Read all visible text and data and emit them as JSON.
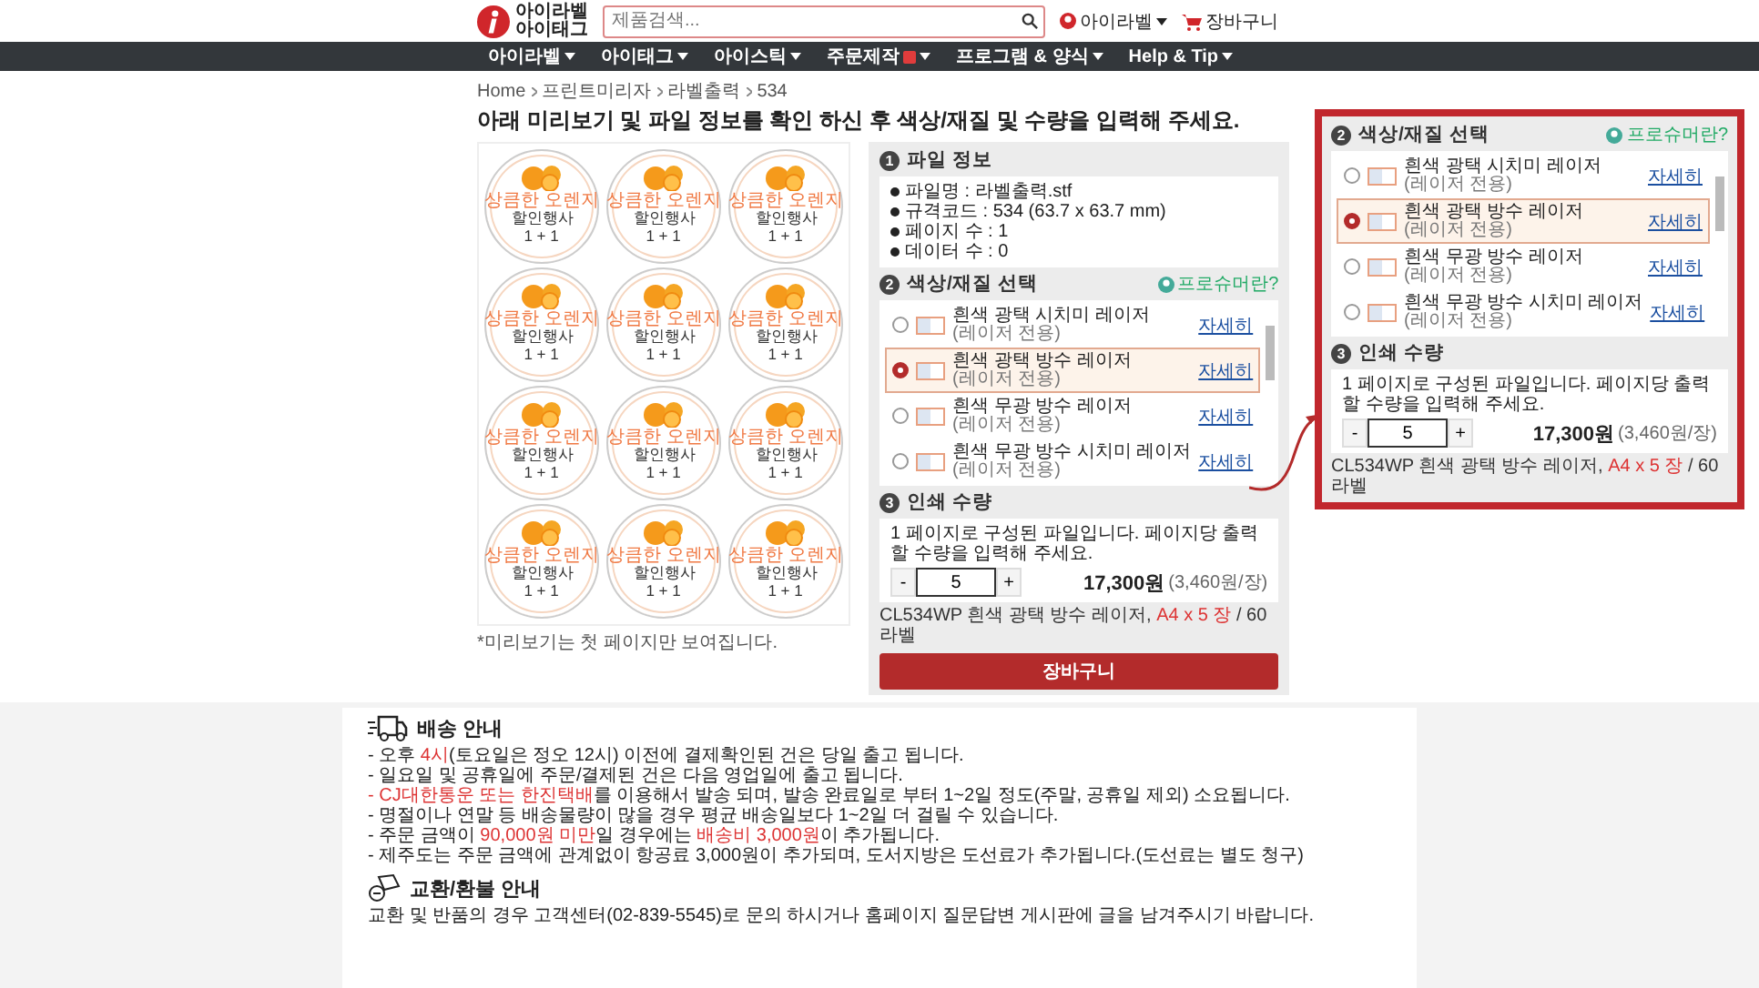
{
  "header": {
    "logo_lines": [
      "아이라벨",
      "아이태그"
    ],
    "search": {
      "placeholder": "제품검색..."
    },
    "user": "아이라벨",
    "cart": "장바구니"
  },
  "nav": [
    {
      "label": "아이라벨",
      "badge": false
    },
    {
      "label": "아이태그",
      "badge": false
    },
    {
      "label": "아이스틱",
      "badge": false
    },
    {
      "label": "주문제작",
      "badge": true
    },
    {
      "label": "프로그램 & 양식",
      "badge": false
    },
    {
      "label": "Help & Tip",
      "badge": false
    }
  ],
  "breadcrumb": [
    "Home",
    "프린트미리자",
    "라벨출력",
    "534"
  ],
  "title": "아래 미리보기 및 파일 정보를 확인 하신 후 색상/재질 및 수량을 입력해 주세요.",
  "preview": {
    "labels": [
      {
        "title": "상큼한 오렌지",
        "line_1": "할인행사",
        "line_2": "1 + 1"
      },
      {
        "title": "상큼한 오렌지",
        "line_1": "할인행사",
        "line_2": "1 + 1"
      },
      {
        "title": "상큼한 오렌지",
        "line_1": "할인행사",
        "line_2": "1 + 1"
      },
      {
        "title": "상큼한 오렌지",
        "line_1": "할인행사",
        "line_2": "1 + 1"
      },
      {
        "title": "상큼한 오렌지",
        "line_1": "할인행사",
        "line_2": "1 + 1"
      },
      {
        "title": "상큼한 오렌지",
        "line_1": "할인행사",
        "line_2": "1 + 1"
      },
      {
        "title": "상큼한 오렌지",
        "line_1": "할인행사",
        "line_2": "1 + 1"
      },
      {
        "title": "상큼한 오렌지",
        "line_1": "할인행사",
        "line_2": "1 + 1"
      },
      {
        "title": "상큼한 오렌지",
        "line_1": "할인행사",
        "line_2": "1 + 1"
      },
      {
        "title": "상큼한 오렌지",
        "line_1": "할인행사",
        "line_2": "1 + 1"
      },
      {
        "title": "상큼한 오렌지",
        "line_1": "할인행사",
        "line_2": "1 + 1"
      },
      {
        "title": "상큼한 오렌지",
        "line_1": "할인행사",
        "line_2": "1 + 1"
      }
    ],
    "note": "*미리보기는 첫 페이지만 보여집니다."
  },
  "file_info": {
    "number": "1",
    "heading": "파일 정보",
    "lines": [
      "파일명 : 라벨출력.stf",
      "규격코드 : 534 (63.7 x 63.7 mm)",
      "페이지 수 : 1",
      "데이터 수 : 0"
    ]
  },
  "material": {
    "number": "2",
    "heading": "색상/재질 선택",
    "help": "프로슈머란?",
    "items": [
      {
        "name": "흰색 광택 시치미 레이저",
        "note": "(레이저 전용)",
        "link": "자세히",
        "selected": false
      },
      {
        "name": "흰색 광택 방수 레이저",
        "note": "(레이저 전용)",
        "link": "자세히",
        "selected": true
      },
      {
        "name": "흰색 무광 방수 레이저",
        "note": "(레이저 전용)",
        "link": "자세히",
        "selected": false
      },
      {
        "name": "흰색 무광 방수 시치미 레이저",
        "note": "(레이저 전용)",
        "link": "자세히",
        "selected": false
      }
    ]
  },
  "quantity": {
    "number": "3",
    "heading": "인쇄 수량",
    "hint": "1 페이지로 구성된 파일입니다. 페이지당 출력 할 수량을 입력해 주세요.",
    "minus": "-",
    "value": "5",
    "plus": "+",
    "price": "17,300원",
    "unit_price": "(3,460원/장)"
  },
  "spec": {
    "product": "CL534WP 흰색 광택 방수 레이저,",
    "sheets": "A4 x 5 장",
    "labels": "/ 60 라벨"
  },
  "cart_button": "장바구니",
  "inset": {
    "material": {
      "number": "2",
      "heading": "색상/재질 선택",
      "help": "프로슈머란?",
      "items": [
        {
          "name": "흰색 광택 시치미 레이저",
          "note": "(레이저 전용)",
          "link": "자세히",
          "selected": false
        },
        {
          "name": "흰색 광택 방수 레이저",
          "note": "(레이저 전용)",
          "link": "자세히",
          "selected": true
        },
        {
          "name": "흰색 무광 방수 레이저",
          "note": "(레이저 전용)",
          "link": "자세히",
          "selected": false
        },
        {
          "name": "흰색 무광 방수 시치미 레이저",
          "note": "(레이저 전용)",
          "link": "자세히",
          "selected": false
        }
      ]
    },
    "quantity": {
      "number": "3",
      "heading": "인쇄 수량",
      "hint": "1 페이지로 구성된 파일입니다. 페이지당 출력 할 수량을 입력해 주세요.",
      "minus": "-",
      "value": "5",
      "plus": "+",
      "price": "17,300원",
      "unit_price": "(3,460원/장)"
    },
    "spec": {
      "product": "CL534WP 흰색 광택 방수 레이저,",
      "sheets": "A4 x 5 장",
      "labels": "/ 60 라벨"
    }
  },
  "delivery": {
    "heading": "배송 안내",
    "lines": [
      [
        {
          "text": "- 오후 ",
          "highlight": false
        },
        {
          "text": "4시",
          "highlight": true
        },
        {
          "text": "(토요일은 정오 12시) 이전에 결제확인된 건은 당일 출고 됩니다.",
          "highlight": false
        }
      ],
      [
        {
          "text": "- 일요일 및 공휴일에 주문/결제된 건은 다음 영업일에 출고 됩니다.",
          "highlight": false
        }
      ],
      [
        {
          "text": "- CJ대한통운 또는 한진택배",
          "highlight": true
        },
        {
          "text": "를 이용해서 발송 되며, 발송 완료일로 부터 1~2일 정도(주말, 공휴일 제외) 소요됩니다.",
          "highlight": false
        }
      ],
      [
        {
          "text": "- 명절이나 연말 등 배송물량이 많을 경우 평균 배송일보다 1~2일 더 걸릴 수 있습니다.",
          "highlight": false
        }
      ],
      [
        {
          "text": "- 주문 금액이 ",
          "highlight": false
        },
        {
          "text": "90,000원 미만",
          "highlight": true
        },
        {
          "text": "일 경우에는 ",
          "highlight": false
        },
        {
          "text": "배송비 3,000원",
          "highlight": true
        },
        {
          "text": "이 추가됩니다.",
          "highlight": false
        }
      ],
      [
        {
          "text": "- 제주도는 주문 금액에 관계없이 항공료 3,000원이 추가되며, 도서지방은 도선료가 추가됩니다.(도선료는 별도 청구)",
          "highlight": false
        }
      ]
    ]
  },
  "refund": {
    "heading": "교환/환불 안내",
    "text": "교환 및 반품의 경우 고객센터(02-839-5545)로 문의 하시거나 홈페이지 질문답변 게시판에 글을 남겨주시기 바랍니다."
  }
}
